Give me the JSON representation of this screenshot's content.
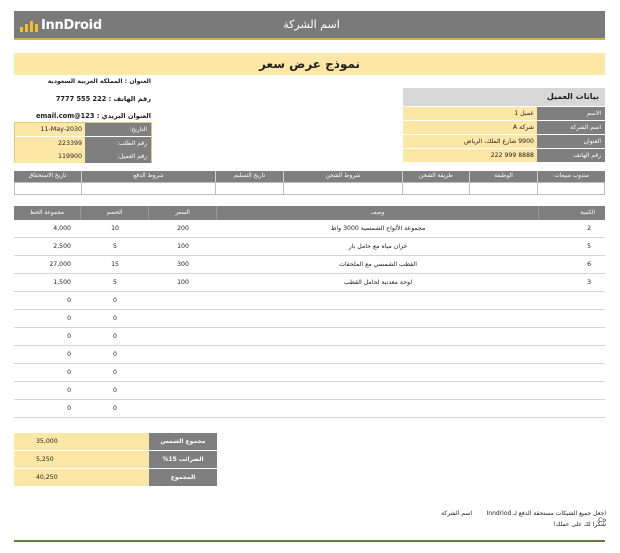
{
  "header": {
    "logo_text": "InnDroid",
    "company_name": "اسم الشركة"
  },
  "title": "نموذج عرض سعر",
  "seller": {
    "address": "العنوان : المملكة العربية السعودية",
    "phone": "رقم الهاتف : 222 555 7777",
    "email": "العنوان البريدي : email.com@123"
  },
  "meta": {
    "date_label": "التاريخ:",
    "date_value": "11-May-2030",
    "order_label": "رقم الطلب:",
    "order_value": "223399",
    "client_label": "رقم العميل:",
    "client_value": "119900"
  },
  "customer": {
    "heading": "بيانات العميل",
    "rows": [
      {
        "label": "الاسم",
        "value": "عميل 1"
      },
      {
        "label": "اسم الشركة",
        "value": "شركة A"
      },
      {
        "label": "العنوان",
        "value": "9900 شارع الملك، الرياض"
      },
      {
        "label": "رقم الهاتف",
        "value": "8888 999 222"
      }
    ]
  },
  "terms_headers": [
    "مندوب مبيعات",
    "الوظيفة",
    "طريقة الشحن",
    "شروط الشحن",
    "تاريخ التسليم",
    "شروط الدفع",
    "تاريخ الاستحقاق"
  ],
  "items": {
    "headers": {
      "qty": "الكمية",
      "desc": "وصف",
      "price": "السعر",
      "discount": "الخصم",
      "total": "مجموعة الخط"
    },
    "rows": [
      {
        "qty": "2",
        "desc": "مجموعة الألواح الشمسية 3000 واط",
        "price": "200",
        "discount": "10",
        "total": "4,000"
      },
      {
        "qty": "5",
        "desc": "خزان مياه مع حامل بار",
        "price": "100",
        "discount": "5",
        "total": "2,500"
      },
      {
        "qty": "6",
        "desc": "القطب الشمسي مع الملحقات",
        "price": "300",
        "discount": "15",
        "total": "27,000"
      },
      {
        "qty": "3",
        "desc": "لوحة معدنية لحامل القطب",
        "price": "100",
        "discount": "5",
        "total": "1,500"
      },
      {
        "qty": "",
        "desc": "",
        "price": "",
        "discount": "0",
        "total": "0"
      },
      {
        "qty": "",
        "desc": "",
        "price": "",
        "discount": "0",
        "total": "0"
      },
      {
        "qty": "",
        "desc": "",
        "price": "",
        "discount": "0",
        "total": "0"
      },
      {
        "qty": "",
        "desc": "",
        "price": "",
        "discount": "0",
        "total": "0"
      },
      {
        "qty": "",
        "desc": "",
        "price": "",
        "discount": "0",
        "total": "0"
      },
      {
        "qty": "",
        "desc": "",
        "price": "",
        "discount": "0",
        "total": "0"
      },
      {
        "qty": "",
        "desc": "",
        "price": "",
        "discount": "0",
        "total": "0"
      }
    ]
  },
  "totals": [
    {
      "label": "مجموع الشمس",
      "value": "35,000"
    },
    {
      "label": "الضرائب 15%",
      "value": "5,250"
    },
    {
      "label": "المجموع",
      "value": "40,250"
    }
  ],
  "footer": {
    "payable": "اجعل جميع الشيكات مستحقة الدفع لـ Inndriod Co.",
    "company": "اسم الشركة",
    "thanks": "شكرا لك على عملك!"
  },
  "colors": {
    "accent": "#f0c030",
    "header_gray": "#7a7a7a",
    "cell_yellow": "#fde7a6",
    "rule_green": "#5e7f3a"
  }
}
